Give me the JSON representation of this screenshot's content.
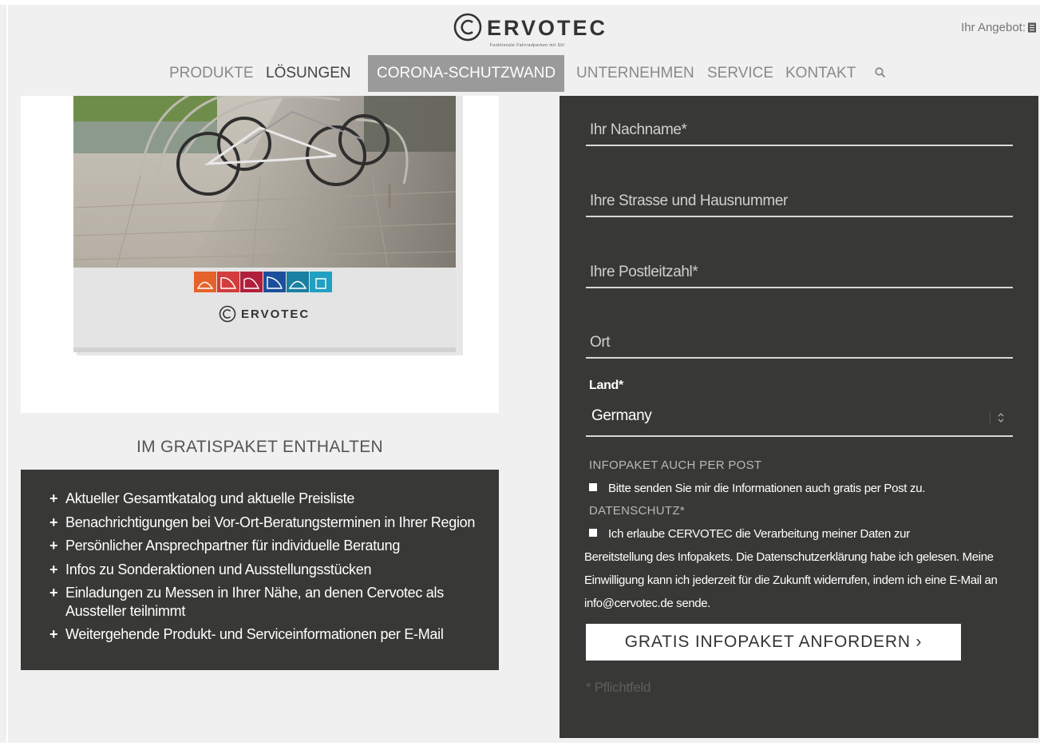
{
  "header": {
    "logo_text": "ERVOTEC",
    "logo_tagline": "Funktionale Fahrradparken mit Stil",
    "offer_label": "Ihr Angebot:"
  },
  "nav": {
    "items": [
      "PRODUKTE",
      "LÖSUNGEN",
      "CORONA-SCHUTZWAND",
      "UNTERNEHMEN",
      "SERVICE",
      "KONTAKT"
    ],
    "active": "CORONA-SCHUTZWAND"
  },
  "catalog": {
    "logo_text": "ERVOTEC",
    "tile_colors": [
      "#e5632a",
      "#d23c3c",
      "#b21f3a",
      "#1b4f9c",
      "#1a7fa0",
      "#21a0c2"
    ]
  },
  "benefits": {
    "title": "IM GRATISPAKET ENTHALTEN",
    "items": [
      "Aktueller Gesamtkatalog und aktuelle Preisliste",
      "Benachrichtigungen bei Vor-Ort-Beratungsterminen in Ihrer Region",
      "Persönlicher Ansprechpartner für individuelle Beratung",
      "Infos zu Sonderaktionen und Ausstellungsstücken",
      "Einladungen zu Messen in Ihrer Nähe, an denen Cervotec als Aussteller teilnimmt",
      "Weitergehende Produkt- und Serviceinformationen per E-Mail"
    ]
  },
  "form": {
    "lastname_placeholder": "Ihr Nachname*",
    "street_placeholder": "Ihre Strasse und Hausnummer",
    "zip_placeholder": "Ihre Postleitzahl*",
    "city_placeholder": "Ort",
    "country_label": "Land*",
    "country_value": "Germany",
    "post_heading": "INFOPAKET AUCH PER POST",
    "post_checkbox_label": "Bitte senden Sie mir die Informationen auch gratis per Post zu.",
    "privacy_heading": "DATENSCHUTZ*",
    "privacy_checkbox_label": "Ich erlaube CERVOTEC die Verarbeitung meiner Daten zur",
    "privacy_text": "Bereitstellung des Infopakets. Die Datenschutzerklärung habe ich gelesen. Meine Einwilligung kann ich jederzeit für die Zukunft widerrufen, indem ich eine E-Mail an info@cervotec.de sende.",
    "submit_label": "GRATIS INFOPAKET ANFORDERN ›",
    "required_note": "* Pflichtfeld"
  },
  "colors": {
    "panel": "#383836",
    "nav_active": "#9a9a9a",
    "background": "#f0f0f0"
  },
  "icons": [
    "document-icon",
    "search-icon",
    "chevron-updown-icon",
    "plus-icon",
    "checkbox-icon"
  ]
}
